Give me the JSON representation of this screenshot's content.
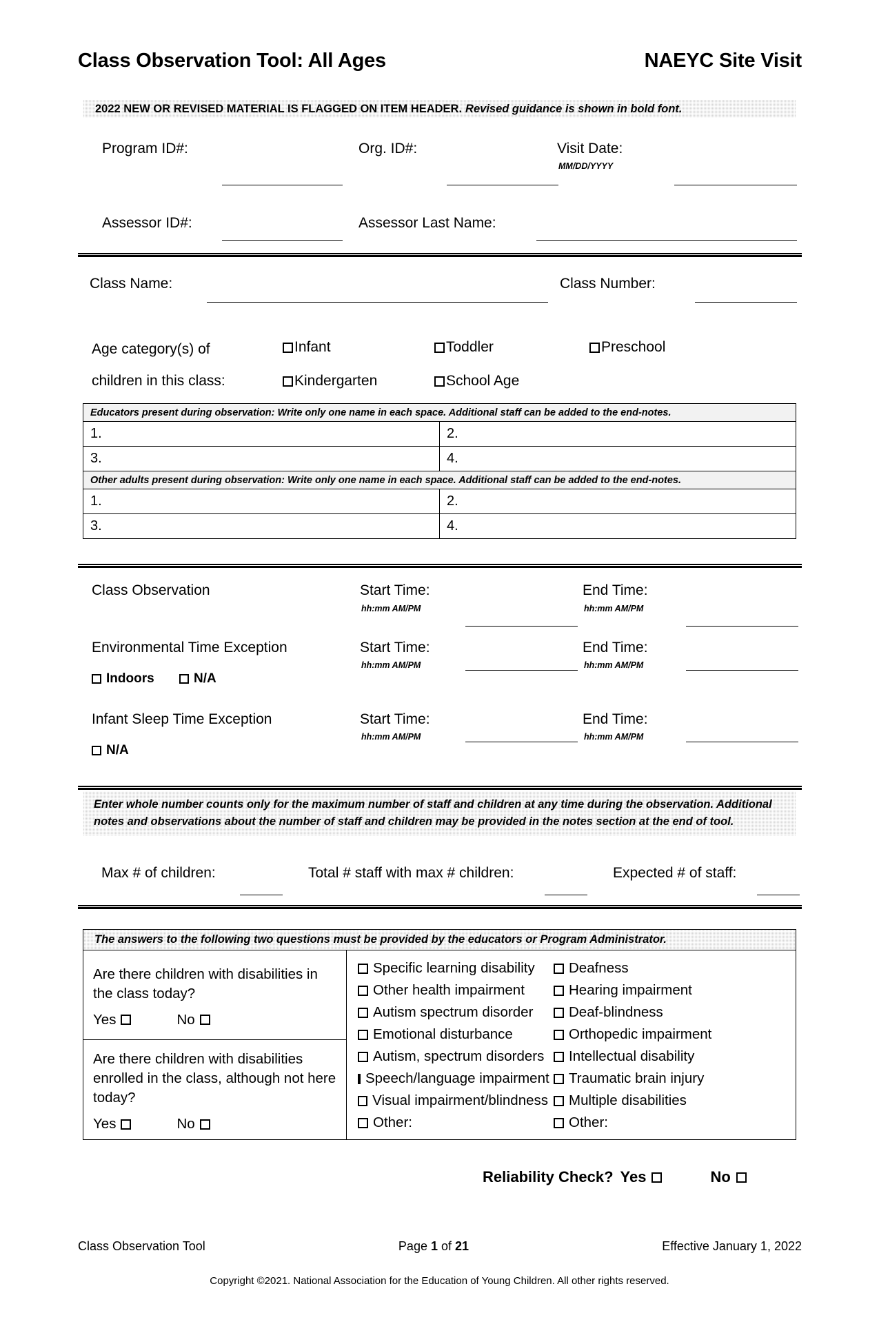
{
  "header": {
    "title": "Class Observation Tool: All Ages",
    "subtitle": "NAEYC Site Visit"
  },
  "notice": {
    "flag_text": "2022 NEW OR REVISED MATERIAL IS FLAGGED ON ITEM HEADER.",
    "bold_note": "Revised guidance is shown in bold font."
  },
  "identification": {
    "program_id_label": "Program ID#:",
    "org_id_label": "Org. ID#:",
    "visit_date_label": "Visit Date:",
    "visit_date_hint": "MM/DD/YYYY",
    "assessor_id_label": "Assessor ID#:",
    "assessor_last_name_label": "Assessor Last Name:"
  },
  "class_info": {
    "class_name_label": "Class Name:",
    "class_number_label": "Class Number:",
    "age_category_label_line1": "Age category(s) of",
    "age_category_label_line2": "children in this class:",
    "age_categories": [
      "Infant",
      "Toddler",
      "Preschool",
      "Kindergarten",
      "School Age"
    ]
  },
  "educators_table": {
    "educators_header": "Educators present during observation:  Write only one name in each space. Additional staff can be added to the end-notes.",
    "other_adults_header": "Other adults present during observation:  Write only one name in each space. Additional staff can be added to the end-notes.",
    "educator_rows": [
      [
        "1.",
        "2."
      ],
      [
        "3.",
        "4."
      ]
    ],
    "other_adult_rows": [
      [
        "1.",
        "2."
      ],
      [
        "3.",
        "4."
      ]
    ]
  },
  "times": {
    "start_label": "Start Time:",
    "end_label": "End Time:",
    "time_hint": "hh:mm AM/PM",
    "rows": [
      {
        "name": "Class Observation",
        "checkboxes": []
      },
      {
        "name": "Environmental Time Exception",
        "checkboxes": [
          "Indoors",
          "N/A"
        ]
      },
      {
        "name": "Infant Sleep Time Exception",
        "checkboxes": [
          "N/A"
        ]
      }
    ]
  },
  "counts": {
    "instruction": "Enter whole number counts only for the maximum number of staff and children at any time during the observation. Additional notes and observations about the number of staff and children may be provided in the notes section at the end of tool.",
    "fields": [
      "Max # of children:",
      "Total # staff with max # children:",
      "Expected # of staff:"
    ]
  },
  "disabilities": {
    "header": "The answers to the following two questions must be provided by the educators or Program Administrator.",
    "questions": [
      {
        "text": "Are there children with disabilities in the class today?",
        "yes_label": "Yes",
        "no_label": "No"
      },
      {
        "text": "Are there children with disabilities enrolled in the class, although not here today?",
        "yes_label": "Yes",
        "no_label": "No"
      }
    ],
    "column_left": [
      "Specific learning disability",
      "Other health impairment",
      "Autism spectrum disorder",
      "Emotional disturbance",
      "Autism, spectrum disorders",
      "Speech/language impairment",
      "Visual impairment/blindness",
      "Other:"
    ],
    "column_right": [
      "Deafness",
      "Hearing impairment",
      "Deaf-blindness",
      "Orthopedic impairment",
      "Intellectual disability",
      "Traumatic brain injury",
      "Multiple disabilities",
      "Other:"
    ]
  },
  "reliability": {
    "label": "Reliability Check?",
    "yes_label": "Yes",
    "no_label": "No"
  },
  "footer": {
    "left": "Class Observation Tool",
    "page_prefix": "Page ",
    "page_current": "1",
    "page_middle": " of ",
    "page_total": "21",
    "right": "Effective January 1, 2022",
    "copyright": "Copyright ©2021. National Association for the Education of Young Children. All other rights reserved."
  }
}
